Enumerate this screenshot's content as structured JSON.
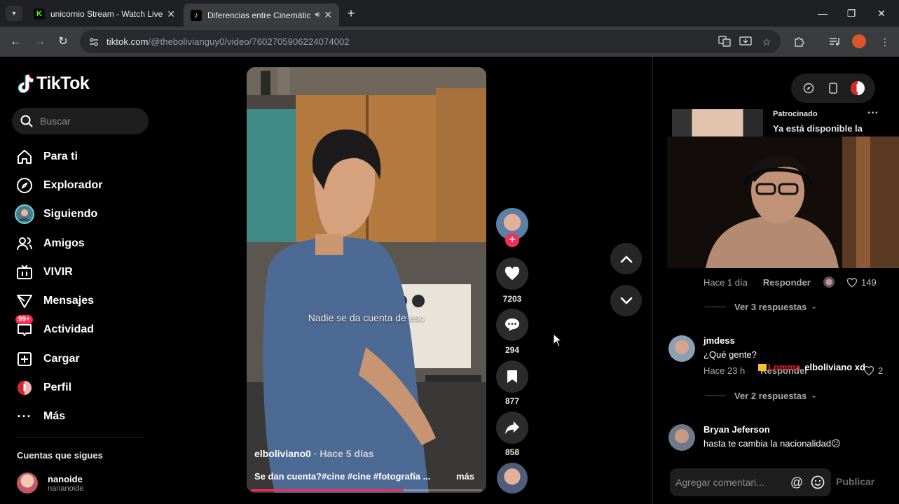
{
  "browser": {
    "tabs": [
      {
        "title": "unicornio Stream - Watch Live o",
        "favicon": "K",
        "favicon_color": "#53fc18",
        "active": false
      },
      {
        "title": "Diferencias entre Cinemátic",
        "favicon": "♪",
        "favicon_color": "#000000",
        "active": true
      }
    ],
    "url_host": "tiktok.com",
    "url_path": "/@thebolivianguy0/video/7602705906224074002"
  },
  "sidebar": {
    "logo": "TikTok",
    "search_placeholder": "Buscar",
    "nav": [
      {
        "label": "Para ti",
        "icon": "home-icon"
      },
      {
        "label": "Explorador",
        "icon": "compass-icon"
      },
      {
        "label": "Siguiendo",
        "icon": "following-avatar-icon"
      },
      {
        "label": "Amigos",
        "icon": "friends-icon"
      },
      {
        "label": "VIVIR",
        "icon": "live-tv-icon"
      },
      {
        "label": "Mensajes",
        "icon": "send-icon"
      },
      {
        "label": "Actividad",
        "icon": "inbox-icon",
        "badge": "99+"
      },
      {
        "label": "Cargar",
        "icon": "upload-icon"
      },
      {
        "label": "Perfil",
        "icon": "profile-icon"
      },
      {
        "label": "Más",
        "icon": "more-icon"
      }
    ],
    "following_title": "Cuentas que sigues",
    "following": [
      {
        "name": "nanoide",
        "username": "nananoide"
      }
    ]
  },
  "video": {
    "caption": "Nadie se da cuenta de eso",
    "author": "elboliviano0",
    "time": " · Hace 5 días",
    "description": "Se dan cuenta?#cine #cine #fotografía ...",
    "more": "más",
    "progress": 0.66
  },
  "actions": {
    "likes": "7203",
    "comments": "294",
    "saves": "877",
    "shares": "858"
  },
  "comments_panel": {
    "ad_label": "Patrocinado",
    "ad_text": "Ya está disponible la",
    "comments": [
      {
        "meta_time": "Hace 1 día",
        "reply_label": "Responder",
        "likes": "149",
        "replies_label": "Ver 3 respuestas"
      },
      {
        "name": "jmdess",
        "text": "¿Qué gente?",
        "meta_time": "Hace 23 h",
        "reply_label": "Responder",
        "likes": "2",
        "replies_label": "Ver 2 respuestas"
      },
      {
        "name": "Bryan Jeferson",
        "text": "hasta te cambia la nacionalidad😕"
      }
    ],
    "overlay_user_1": "Lomma",
    "overlay_user_2": "elboliviano xd",
    "composer_placeholder": "Agregar comentari...",
    "publish_label": "Publicar"
  },
  "colors": {
    "accent": "#fe2c55",
    "background": "#000000"
  }
}
